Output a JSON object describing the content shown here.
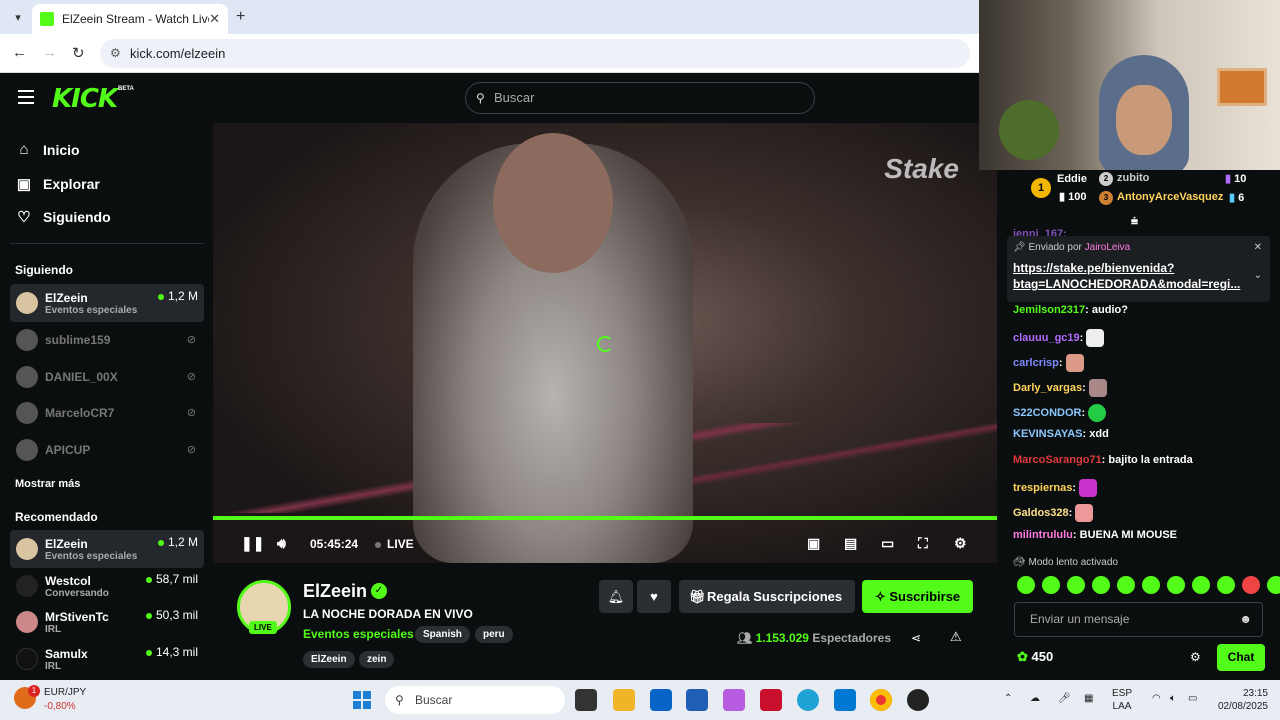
{
  "browser": {
    "tab_title": "ElZeein Stream - Watch Live on",
    "close": "✕",
    "new_tab": "+",
    "url": "kick.com/elzeein"
  },
  "header": {
    "logo": "KICK",
    "beta": "BETA",
    "search_placeholder": "Buscar"
  },
  "sidebar": {
    "nav": [
      {
        "label": "Inicio",
        "icon": "home-icon"
      },
      {
        "label": "Explorar",
        "icon": "explore-icon"
      },
      {
        "label": "Siguiendo",
        "icon": "heart-icon"
      }
    ],
    "following_title": "Siguiendo",
    "following": [
      {
        "name": "ElZeein",
        "sub": "Eventos especiales",
        "viewers": "1,2 M"
      },
      {
        "name": "sublime159"
      },
      {
        "name": "DANIEL_00X"
      },
      {
        "name": "MarceloCR7"
      },
      {
        "name": "APICUP"
      }
    ],
    "show_more": "Mostrar más",
    "recommended_title": "Recomendado",
    "recommended": [
      {
        "name": "ElZeein",
        "sub": "Eventos especiales",
        "viewers": "1,2 M"
      },
      {
        "name": "Westcol",
        "sub": "Conversando",
        "viewers": "58,7 mil"
      },
      {
        "name": "MrStivenTc",
        "sub": "IRL",
        "viewers": "50,3 mil"
      },
      {
        "name": "Samulx",
        "sub": "IRL",
        "viewers": "14,3 mil"
      }
    ]
  },
  "player": {
    "watermark": "Stake",
    "time": "05:45:24",
    "live": "LIVE",
    "progress": 1.0
  },
  "stream": {
    "channel": "ElZeein",
    "live_badge": "LIVE",
    "title": "LA NOCHE DORADA EN VIVO",
    "category": "Eventos especiales",
    "tags": [
      "Spanish",
      "peru"
    ],
    "tags2": [
      "ElZeein",
      "zein"
    ],
    "gift_label": "Regala Suscripciones",
    "subscribe_label": "Suscribirse",
    "viewers_count": "1.153.029",
    "viewers_label": "Espectadores"
  },
  "chat": {
    "leaderboard": {
      "first": {
        "name": "Eddie",
        "score": "100"
      },
      "second": {
        "name": "zubito",
        "score": "10"
      },
      "third": {
        "name": "AntonyArceVasquez",
        "score": "6"
      }
    },
    "partial_user": "ienni_167:",
    "pinned": {
      "by_label": "Enviado por",
      "by_user": "JairoLeiva",
      "link": "https://stake.pe/bienvenida?btag=LANOCHEDORADA&modal=regi..."
    },
    "messages": [
      {
        "user": "Jemilson2317",
        "color": "#53fc18",
        "text": "audio?"
      },
      {
        "user": "clauuu_gc19",
        "color": "#b06cff",
        "text": ""
      },
      {
        "user": "carlcrisp",
        "color": "#7c8cff",
        "text": ""
      },
      {
        "user": "Darly_vargas",
        "color": "#ffd35c",
        "text": ""
      },
      {
        "user": "S22CONDOR",
        "color": "#8cc8ff",
        "text": ""
      },
      {
        "user": "KEVINSAYAS",
        "color": "#8cc8ff",
        "text": "xdd"
      },
      {
        "user": "MarcoSarango71",
        "color": "#e03a3a",
        "text": "bajito la entrada"
      },
      {
        "user": "trespiernas",
        "color": "#ffd35c",
        "text": ""
      },
      {
        "user": "Galdos328",
        "color": "#ffe08a",
        "text": ""
      },
      {
        "user": "milintrululu",
        "color": "#ff7adf",
        "text": "BUENA MI MOUSE"
      }
    ],
    "slow_mode": "Modo lento activado",
    "input_placeholder": "Enviar un mensaje",
    "points": "450",
    "chat_button": "Chat"
  },
  "taskbar": {
    "ticker": "EUR/JPY",
    "change": "-0,80%",
    "badge": "1",
    "search": "Buscar",
    "lang": "ESP",
    "layout": "LAA",
    "time": "23:15",
    "date": "02/08/2025"
  }
}
